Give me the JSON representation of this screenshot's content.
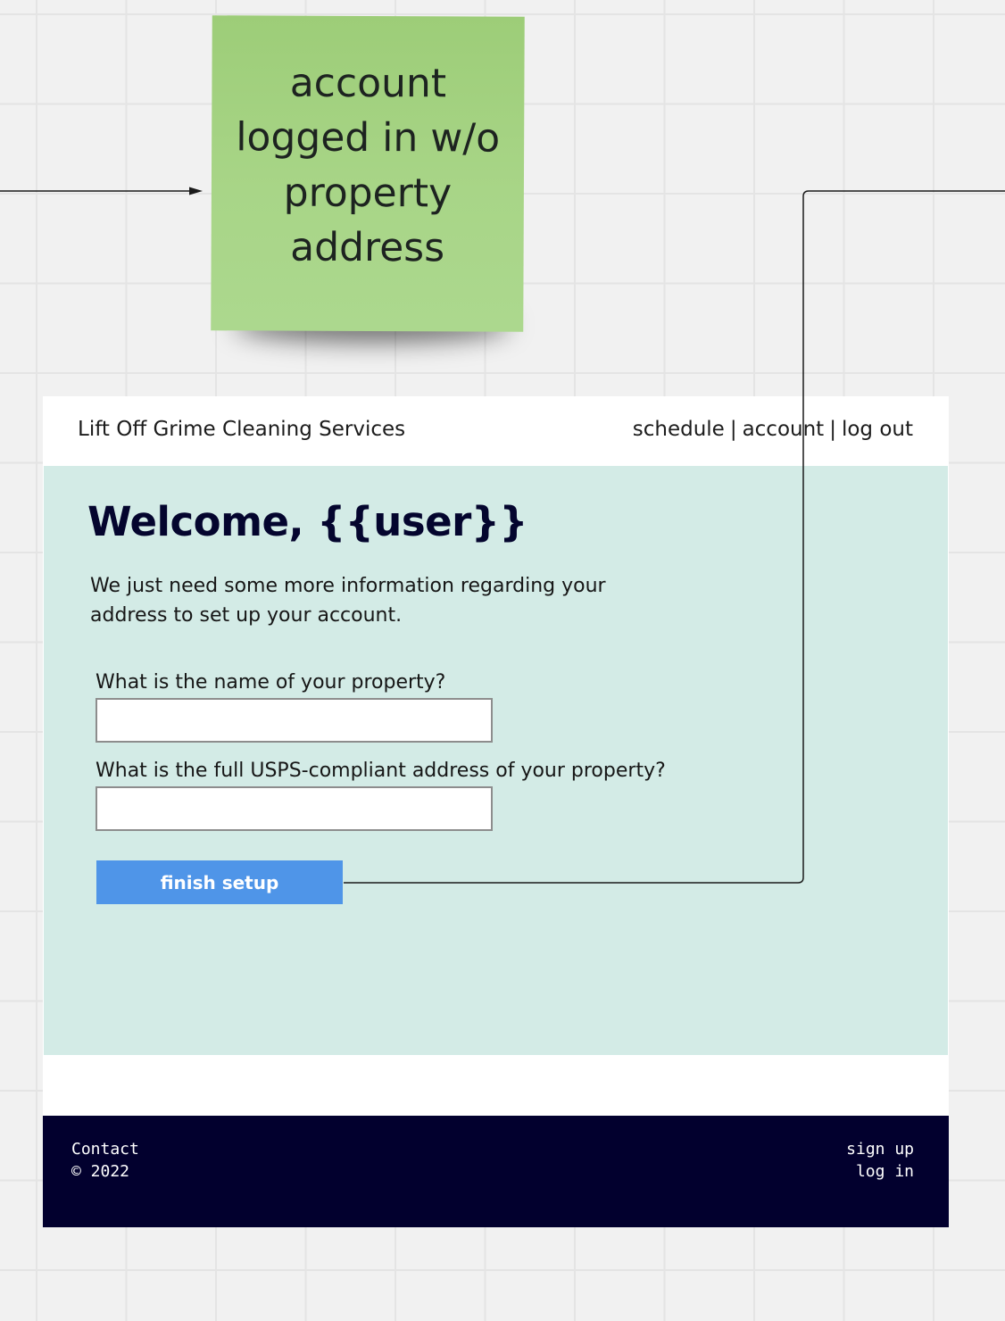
{
  "sticky_note": {
    "text": "account logged in w/o property address",
    "color": "#a6d382"
  },
  "header": {
    "brand": "Lift Off Grime Cleaning Services",
    "nav": [
      "schedule",
      "account",
      "log out"
    ]
  },
  "main": {
    "welcome": "Welcome, {{user}}",
    "intro": "We just need some more information regarding your address to set up your account.",
    "fields": [
      {
        "label": "What is the name of your property?",
        "value": ""
      },
      {
        "label": "What is the full USPS-compliant address of your property?",
        "value": ""
      }
    ],
    "button_label": "finish setup",
    "background": "#d3ebe6",
    "button_color": "#4f95e8"
  },
  "footer": {
    "contact": "Contact",
    "copyright": "© 2022",
    "sign_up": "sign up",
    "log_in": "log in",
    "background": "#02002e"
  }
}
